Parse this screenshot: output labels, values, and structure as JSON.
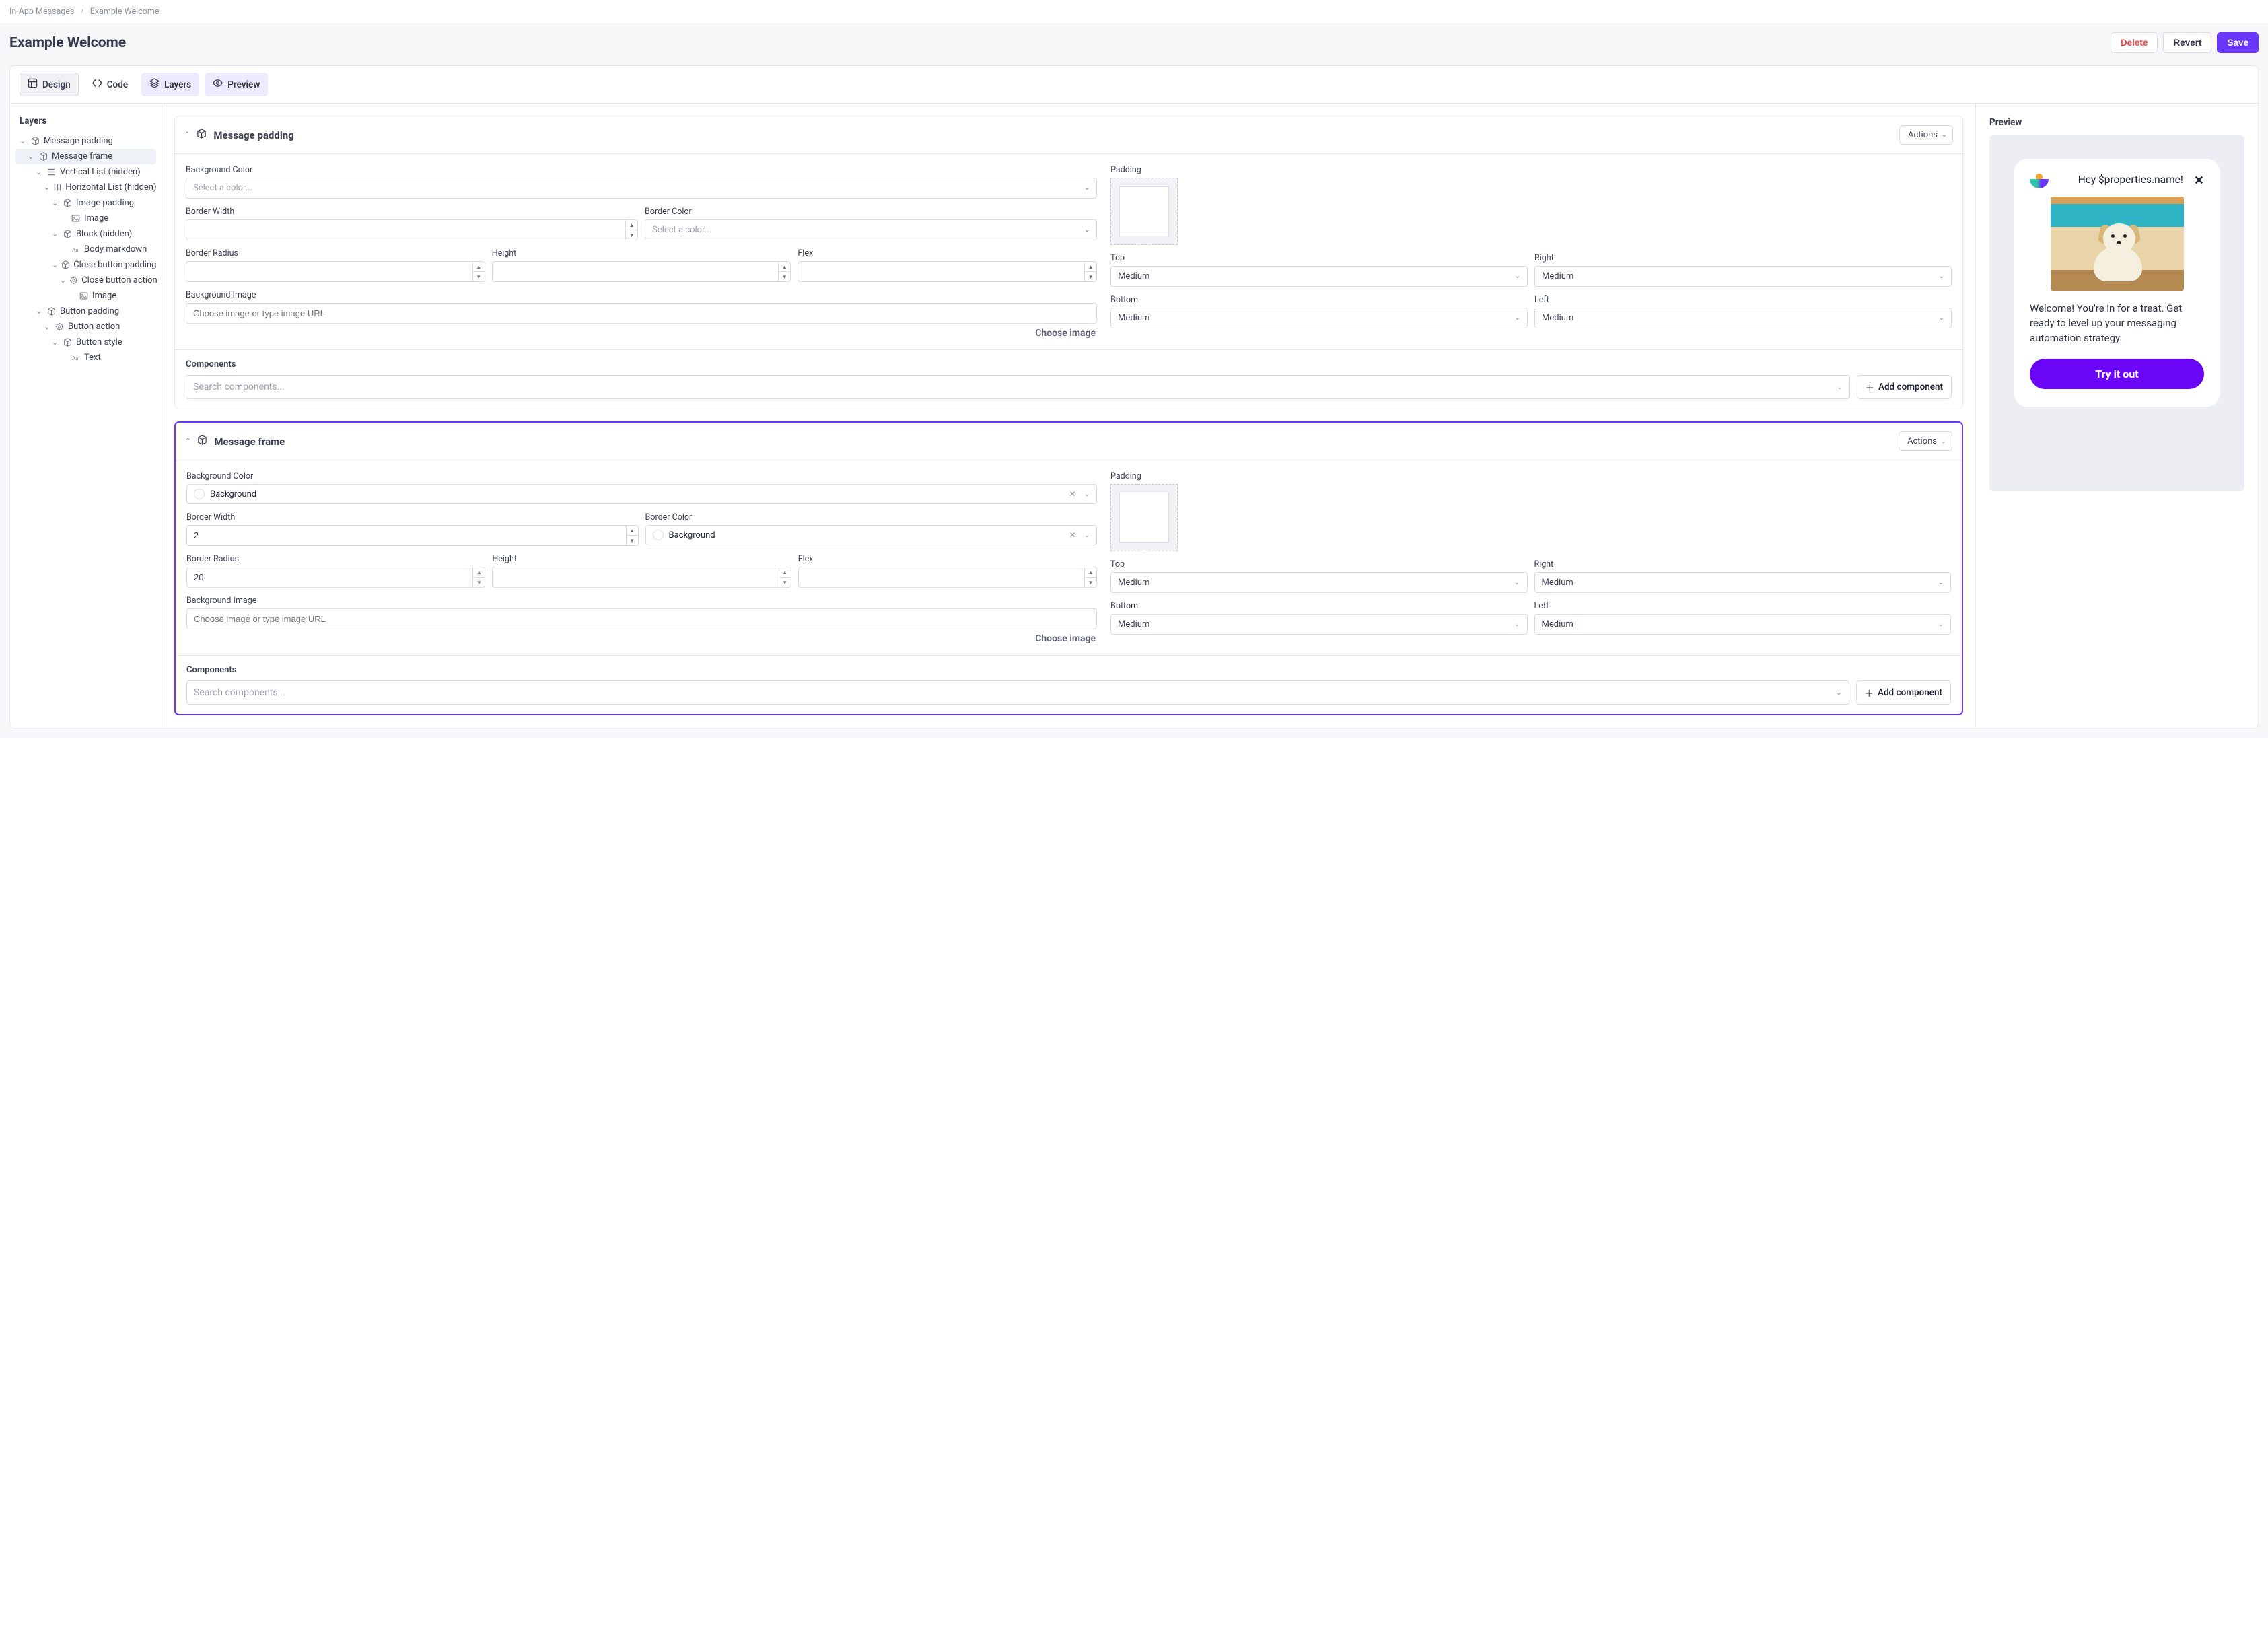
{
  "breadcrumb": {
    "parent": "In-App Messages",
    "current": "Example Welcome"
  },
  "header": {
    "title": "Example Welcome",
    "delete": "Delete",
    "revert": "Revert",
    "save": "Save"
  },
  "tabs": {
    "design": "Design",
    "code": "Code",
    "layers": "Layers",
    "preview": "Preview"
  },
  "layersPanel": {
    "title": "Layers",
    "items": [
      {
        "indent": 0,
        "label": "Message padding",
        "icon": "box",
        "chev": true
      },
      {
        "indent": 1,
        "label": "Message frame",
        "icon": "box",
        "chev": true,
        "selected": true
      },
      {
        "indent": 2,
        "label": "Vertical List (hidden)",
        "icon": "list",
        "chev": true
      },
      {
        "indent": 3,
        "label": "Horizontal List (hidden)",
        "icon": "hlist",
        "chev": true
      },
      {
        "indent": 4,
        "label": "Image padding",
        "icon": "box",
        "chev": true
      },
      {
        "indent": 5,
        "label": "Image",
        "icon": "image",
        "chev": false
      },
      {
        "indent": 4,
        "label": "Block (hidden)",
        "icon": "box",
        "chev": true
      },
      {
        "indent": 5,
        "label": "Body markdown",
        "icon": "text",
        "chev": false
      },
      {
        "indent": 4,
        "label": "Close button padding",
        "icon": "box",
        "chev": true
      },
      {
        "indent": 5,
        "label": "Close button action",
        "icon": "target",
        "chev": true
      },
      {
        "indent": 6,
        "label": "Image",
        "icon": "image",
        "chev": false
      },
      {
        "indent": 2,
        "label": "Button padding",
        "icon": "box",
        "chev": true
      },
      {
        "indent": 3,
        "label": "Button action",
        "icon": "target",
        "chev": true
      },
      {
        "indent": 4,
        "label": "Button style",
        "icon": "box",
        "chev": true
      },
      {
        "indent": 5,
        "label": "Text",
        "icon": "text",
        "chev": false
      }
    ]
  },
  "labels": {
    "bgColor": "Background Color",
    "borderWidth": "Border Width",
    "borderColor": "Border Color",
    "borderRadius": "Border Radius",
    "height": "Height",
    "flex": "Flex",
    "bgImage": "Background Image",
    "padding": "Padding",
    "top": "Top",
    "right": "Right",
    "bottom": "Bottom",
    "left": "Left",
    "components": "Components",
    "addComponent": "Add component",
    "chooseImage": "Choose image",
    "actions": "Actions",
    "medium": "Medium"
  },
  "placeholders": {
    "selectColor": "Select a color...",
    "chooseImage": "Choose image or type image URL",
    "searchComponents": "Search components..."
  },
  "card1": {
    "title": "Message padding",
    "bgColor": "",
    "borderWidth": "",
    "borderColor": "",
    "borderRadius": "",
    "height": "",
    "flex": "",
    "bgImage": "",
    "top": "Medium",
    "right": "Medium",
    "bottom": "Medium",
    "left": "Medium"
  },
  "card2": {
    "title": "Message frame",
    "bgColor": "Background",
    "borderWidth": "2",
    "borderColor": "Background",
    "borderRadius": "20",
    "height": "",
    "flex": "",
    "bgImage": "",
    "top": "Medium",
    "right": "Medium",
    "bottom": "Medium",
    "left": "Medium"
  },
  "preview": {
    "title": "Preview",
    "greeting": "Hey $properties.name!",
    "body": "Welcome! You're in for a treat. Get ready to level up your messaging automation strategy.",
    "button": "Try it out"
  }
}
